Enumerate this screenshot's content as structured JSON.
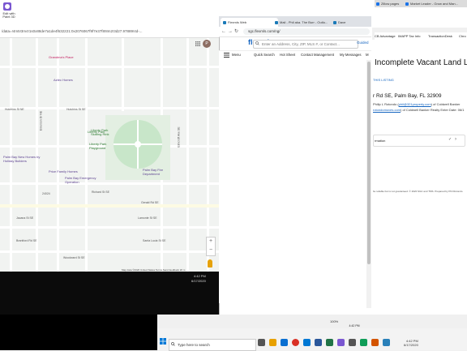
{
  "back_window": {
    "paint_label": "Edit with Paint 3D",
    "tabs": [
      "Zillow pages",
      "Market Leader - Grow and Man..."
    ],
    "bookmarks": [
      "CB Advantage",
      "IMAPP Tax Info",
      "TransactionDesk",
      "Chro"
    ]
  },
  "map": {
    "url": "/data=!4m5!3m4!1s0x88de7a1de4f632221:0x2076067f9f7e37f8!8m2!3d27.97889!4d-...",
    "avatar": "P",
    "clock_time": "4:42 PM",
    "clock_date": "6/17/2020",
    "footer": "Map data ©2020   United States   Terms   Send feedback   20 m",
    "pois": {
      "skating_rink": "Liberty Park Skating Rink",
      "playground": "Liberty Park Playground",
      "liberty_park": "Liberty Park",
      "new_homes": "Palm Bay New Homes by Holiday Builders",
      "price_homes": "Price Family Homes",
      "emergency": "Palm Bay Emergency Operation",
      "fire": "Palm Bay Fire Department",
      "grandma": "Grandma's Place",
      "aztec": "Aztec Homes"
    },
    "streets": {
      "emerson": "Emerson Dr NE",
      "hutchins1": "Hutchins St SE",
      "hutchins2": "Hutchins St NE",
      "richard": "Richard St SE",
      "elmcroft": "Elmcroft Ave SE",
      "hamlet": "Hamlet Dr SE",
      "gerald": "Gerald Rd SE",
      "irvin": "Irvin Ave SE",
      "jacana": "Jacana St SE",
      "lamonte": "Lamonte St SE",
      "brantford": "Brantford Rd SE",
      "santa_lucia": "Santa Lucia St SE",
      "wood": "Woodward St SE",
      "road_24024": "24024"
    }
  },
  "flex": {
    "tabs": [
      "Flexmls Web",
      "Mail - Phil aka. The Burr - Outlo...",
      "Dave"
    ],
    "url": "sgc.flexmls.com/ng/",
    "logo": "flexmls",
    "search_placeholder": "Enter an Address, City, ZIP, MLS #, or Contact...",
    "guided": "Guided",
    "menu": [
      "Menu",
      "Quick Search",
      "Hot Sheet",
      "Contact Management",
      "My Messages",
      "M"
    ]
  },
  "listing": {
    "title": "Incomplete Vacant Land Lis",
    "sub": "THIS LISTING",
    "address": "r Rd SE, Palm Bay, FL 32909",
    "agent_line1_prefix": "Philip L Rotondo (",
    "agent_line1_email": "phil@321property.com",
    "agent_line1_suffix": ") of Coldwell Banker",
    "agent_line2_email": "rotondomoves.com",
    "agent_line2_suffix": ") of Coldwell Banker Realty  Enter Date: 06/1",
    "info_label": "rmation",
    "check": "✓",
    "chevron": "›",
    "disclaimer": "be reliable but is not guaranteed. © 2020 SGC and TMS. Prepared by Phil Rotondo"
  },
  "status": {
    "zoom": "100%",
    "clock_time": "4:42 PM",
    "clock_date": "6/17/2020"
  },
  "taskbar": {
    "search_placeholder": "Type here to search",
    "tray_time": "4:42 PM",
    "tray_date": "6/17/2020"
  },
  "colors": {
    "flex_blue": "#1565c0",
    "park_green": "#c8e6c9",
    "map_bg": "#eef0ed"
  }
}
